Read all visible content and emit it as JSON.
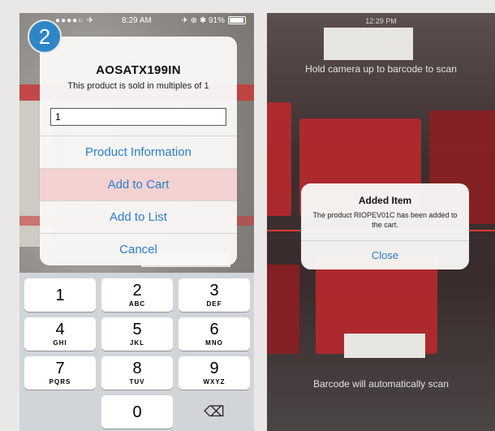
{
  "badge": {
    "number": "2"
  },
  "left_status": {
    "signal": "●●●●○ ✈",
    "time": "8:29 AM",
    "right": "✈ ⊕ ✱ 91%"
  },
  "product_alert": {
    "title": "AOSATX199IN",
    "message": "This product is sold in multiples of 1",
    "quantity_value": "1",
    "buttons": [
      "Product Information",
      "Add to Cart",
      "Add to List",
      "Cancel"
    ]
  },
  "keypad": {
    "keys": [
      {
        "num": "1",
        "letters": ""
      },
      {
        "num": "2",
        "letters": "ABC"
      },
      {
        "num": "3",
        "letters": "DEF"
      },
      {
        "num": "4",
        "letters": "GHI"
      },
      {
        "num": "5",
        "letters": "JKL"
      },
      {
        "num": "6",
        "letters": "MNO"
      },
      {
        "num": "7",
        "letters": "PQRS"
      },
      {
        "num": "8",
        "letters": "TUV"
      },
      {
        "num": "9",
        "letters": "WXYZ"
      },
      {
        "num": "0",
        "letters": ""
      }
    ],
    "delete_icon": "⌫"
  },
  "scanner": {
    "time": "12:29 PM",
    "hint_top": "Hold camera up to barcode to scan",
    "hint_bottom": "Barcode will automatically scan"
  },
  "added_alert": {
    "title": "Added Item",
    "message": "The product RIOPEV01C has been added to the cart.",
    "button": "Close"
  },
  "colors": {
    "accent": "#2b7ed0",
    "badge": "#2f86c6",
    "highlight": "#f3d2d1",
    "scanline": "#e53935"
  }
}
